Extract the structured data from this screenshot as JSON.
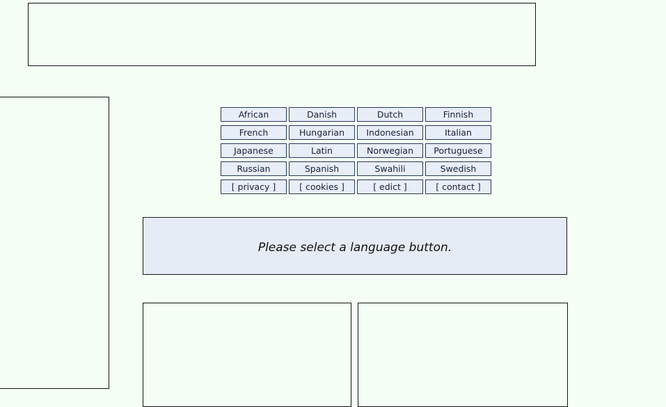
{
  "page": {
    "background_color": "#f5fff5"
  },
  "placeholders": [
    {
      "name": "top-banner-frame"
    },
    {
      "name": "left-sidebar-frame"
    },
    {
      "name": "bottom-left-frame"
    },
    {
      "name": "bottom-right-frame"
    }
  ],
  "language_grid": {
    "button_fill_color": "#e8eef7",
    "button_border_color": "#23395b",
    "rows": [
      [
        {
          "label": "African"
        },
        {
          "label": "Danish"
        },
        {
          "label": "Dutch"
        },
        {
          "label": "Finnish"
        }
      ],
      [
        {
          "label": "French"
        },
        {
          "label": "Hungarian"
        },
        {
          "label": "Indonesian"
        },
        {
          "label": "Italian"
        }
      ],
      [
        {
          "label": "Japanese"
        },
        {
          "label": "Latin"
        },
        {
          "label": "Norwegian"
        },
        {
          "label": "Portuguese"
        }
      ],
      [
        {
          "label": "Russian"
        },
        {
          "label": "Spanish"
        },
        {
          "label": "Swahili"
        },
        {
          "label": "Swedish"
        }
      ],
      [
        {
          "label": "[ privacy ]"
        },
        {
          "label": "[ cookies ]"
        },
        {
          "label": "[ edict ]"
        },
        {
          "label": "[ contact ]"
        }
      ]
    ]
  },
  "message_panel": {
    "text": "Please select a language button.",
    "background_color": "#e6ecf5",
    "border_color": "#1a1a1a"
  }
}
